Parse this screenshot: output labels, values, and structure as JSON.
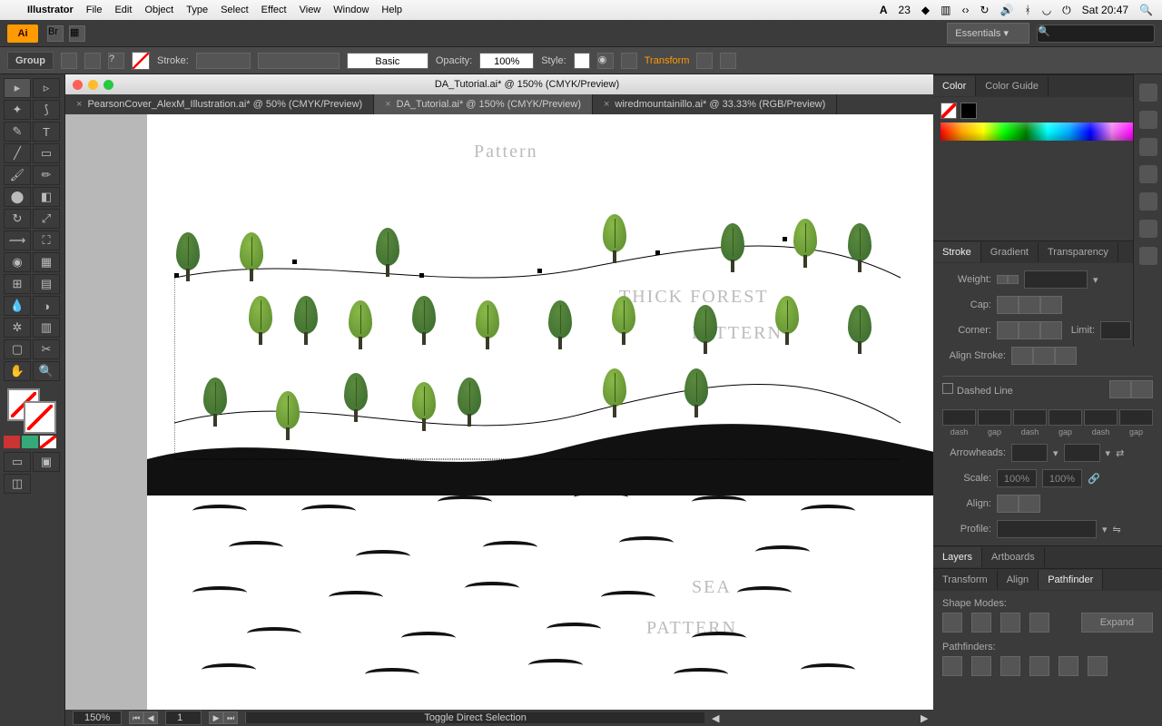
{
  "menubar": {
    "app": "Illustrator",
    "items": [
      "File",
      "Edit",
      "Object",
      "Type",
      "Select",
      "Effect",
      "View",
      "Window",
      "Help"
    ],
    "right": {
      "adobe": "A",
      "count": "23",
      "clock": "Sat 20:47"
    }
  },
  "workspace": "Essentials",
  "control": {
    "group": "Group",
    "stroke": "Stroke:",
    "basic": "Basic",
    "opacity": "Opacity:",
    "opval": "100%",
    "style": "Style:",
    "transform": "Transform"
  },
  "doc": {
    "title": "DA_Tutorial.ai* @ 150% (CMYK/Preview)"
  },
  "tabs": [
    {
      "label": "PearsonCover_AlexM_Illustration.ai* @ 50% (CMYK/Preview)",
      "active": false
    },
    {
      "label": "DA_Tutorial.ai* @ 150% (CMYK/Preview)",
      "active": true
    },
    {
      "label": "wiredmountainillo.ai* @ 33.33% (RGB/Preview)",
      "active": false
    }
  ],
  "bottom": {
    "zoom": "150%",
    "artboard": "1",
    "tip": "Toggle Direct Selection"
  },
  "panels": {
    "color": {
      "tabs": [
        "Color",
        "Color Guide"
      ]
    },
    "stroke": {
      "tabs": [
        "Stroke",
        "Gradient",
        "Transparency"
      ],
      "weight": "Weight:",
      "cap": "Cap:",
      "corner": "Corner:",
      "limit": "Limit:",
      "align": "Align Stroke:",
      "dashed": "Dashed Line",
      "labels": [
        "dash",
        "gap",
        "dash",
        "gap",
        "dash",
        "gap"
      ],
      "arrow": "Arrowheads:",
      "scale": "Scale:",
      "scval": "100%",
      "align2": "Align:",
      "profile": "Profile:"
    },
    "layers": {
      "tabs": [
        "Layers",
        "Artboards"
      ]
    },
    "pathfinder": {
      "tabs": [
        "Transform",
        "Align",
        "Pathfinder"
      ],
      "shapemodes": "Shape Modes:",
      "expand": "Expand",
      "pathfinders": "Pathfinders:"
    }
  },
  "sketch": {
    "pattern": "Pattern",
    "thick": "THICK FOREST",
    "thick2": "PATTERN",
    "sea": "SEA",
    "sea2": "PATTERN"
  }
}
